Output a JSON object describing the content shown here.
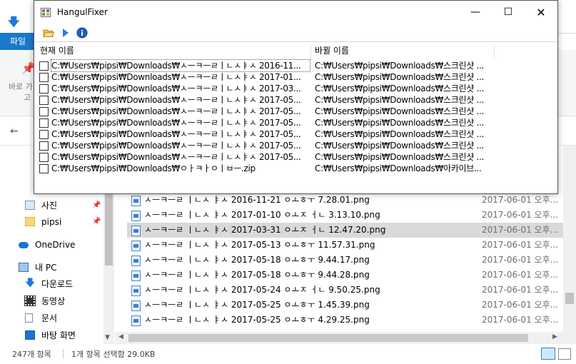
{
  "explorer": {
    "file_tab": "파일",
    "ribbon_text1": "바로 가",
    "ribbon_text2": "고",
    "nav": [
      {
        "label": "사진",
        "pinned": true
      },
      {
        "label": "pipsi",
        "pinned": true
      },
      {
        "label": "OneDrive",
        "pinned": false
      },
      {
        "label": "내 PC",
        "pinned": false
      },
      {
        "label": "다운로드",
        "pinned": false
      },
      {
        "label": "동영상",
        "pinned": false
      },
      {
        "label": "문서",
        "pinned": false
      },
      {
        "label": "바탕 화면",
        "pinned": false
      }
    ],
    "files": [
      {
        "name": "ㅅㅡㅋㅡㄹ ㅣㄴㅅ ㅑㅅ 2016-11-21 ㅇㅗㅎㅜ 7.28.01.png",
        "date": "2017-06-01 오후..."
      },
      {
        "name": "ㅅㅡㅋㅡㄹ ㅣㄴㅅ ㅑㅅ 2017-01-10 ㅇㅗㅈ ㅓㄴ 3.13.10.png",
        "date": "2017-06-01 오후..."
      },
      {
        "name": "ㅅㅡㅋㅡㄹ ㅣㄴㅅ ㅑㅅ 2017-03-31 ㅇㅗㅈ ㅓㄴ 12.47.20.png",
        "date": "2017-06-01 오후..."
      },
      {
        "name": "ㅅㅡㅋㅡㄹ ㅣㄴㅅ ㅑㅅ 2017-05-13 ㅇㅗㅎㅜ 11.57.31.png",
        "date": "2017-06-01 오후..."
      },
      {
        "name": "ㅅㅡㅋㅡㄹ ㅣㄴㅅ ㅑㅅ 2017-05-18 ㅇㅗㅎㅜ 9.44.17.png",
        "date": "2017-06-01 오후..."
      },
      {
        "name": "ㅅㅡㅋㅡㄹ ㅣㄴㅅ ㅑㅅ 2017-05-18 ㅇㅗㅎㅜ 9.44.28.png",
        "date": "2017-06-01 오후..."
      },
      {
        "name": "ㅅㅡㅋㅡㄹ ㅣㄴㅅ ㅑㅅ 2017-05-24 ㅇㅗㅈ ㅓㄴ 9.50.25.png",
        "date": "2017-06-01 오후..."
      },
      {
        "name": "ㅅㅡㅋㅡㄹ ㅣㄴㅅ ㅑㅅ 2017-05-25 ㅇㅗㅎㅜ 1.45.39.png",
        "date": "2017-06-01 오후..."
      },
      {
        "name": "ㅅㅡㅋㅡㄹ ㅣㄴㅅ ㅑㅅ 2017-05-25 ㅇㅗㅎㅜ 4.29.25.png",
        "date": "2017-06-01 오후..."
      }
    ],
    "selected_file_index": 2,
    "status_count": "247개 항목",
    "status_selected": "1개 항목 선택함 29.0KB"
  },
  "hangulfixer": {
    "title": "HangulFixer",
    "minimize": "—",
    "maximize": "☐",
    "close": "✕",
    "columns": {
      "current": "현재 이름",
      "new": "바뀔 이름"
    },
    "rows": [
      {
        "current": "C:₩Users₩pipsi₩Downloads₩ㅅㅡㅋㅡㄹㅣㄴㅅㅑㅅ 2016-11...",
        "new": "C:₩Users₩pipsi₩Downloads₩스크린샷 ...",
        "checked": false
      },
      {
        "current": "C:₩Users₩pipsi₩Downloads₩ㅅㅡㅋㅡㄹㅣㄴㅅㅑㅅ 2017-01...",
        "new": "C:₩Users₩pipsi₩Downloads₩스크린샷 ...",
        "checked": false
      },
      {
        "current": "C:₩Users₩pipsi₩Downloads₩ㅅㅡㅋㅡㄹㅣㄴㅅㅑㅅ 2017-03...",
        "new": "C:₩Users₩pipsi₩Downloads₩스크린샷 ...",
        "checked": false
      },
      {
        "current": "C:₩Users₩pipsi₩Downloads₩ㅅㅡㅋㅡㄹㅣㄴㅅㅑㅅ 2017-05...",
        "new": "C:₩Users₩pipsi₩Downloads₩스크린샷 ...",
        "checked": false
      },
      {
        "current": "C:₩Users₩pipsi₩Downloads₩ㅅㅡㅋㅡㄹㅣㄴㅅㅑㅅ 2017-05...",
        "new": "C:₩Users₩pipsi₩Downloads₩스크린샷 ...",
        "checked": false
      },
      {
        "current": "C:₩Users₩pipsi₩Downloads₩ㅅㅡㅋㅡㄹㅣㄴㅅㅑㅅ 2017-05...",
        "new": "C:₩Users₩pipsi₩Downloads₩스크린샷 ...",
        "checked": false
      },
      {
        "current": "C:₩Users₩pipsi₩Downloads₩ㅅㅡㅋㅡㄹㅣㄴㅅㅑㅅ 2017-05...",
        "new": "C:₩Users₩pipsi₩Downloads₩스크린샷 ...",
        "checked": false
      },
      {
        "current": "C:₩Users₩pipsi₩Downloads₩ㅅㅡㅋㅡㄹㅣㄴㅅㅑㅅ 2017-05...",
        "new": "C:₩Users₩pipsi₩Downloads₩스크린샷 ...",
        "checked": false
      },
      {
        "current": "C:₩Users₩pipsi₩Downloads₩ㅅㅡㅋㅡㄹㅣㄴㅅㅑㅅ 2017-05...",
        "new": "C:₩Users₩pipsi₩Downloads₩스크린샷 ...",
        "checked": false
      },
      {
        "current": "C:₩Users₩pipsi₩Downloads₩ㅇㅏㅋㅏㅇㅣㅂㅡ.zip",
        "new": "C:₩Users₩pipsi₩Downloads₩아카이브...",
        "checked": false
      }
    ],
    "focused_row_index": 0
  },
  "colors": {
    "accent": "#1979ca",
    "selection_row": "#d9d9d9",
    "nav_selected": "#cce8ff"
  }
}
